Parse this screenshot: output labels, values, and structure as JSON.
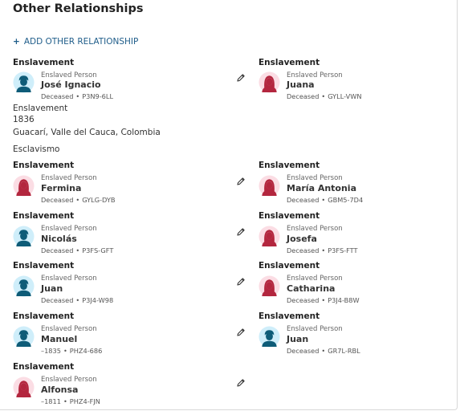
{
  "section": {
    "title": "Other Relationships",
    "add_label": "ADD OTHER RELATIONSHIP",
    "add_icon": "plus-icon"
  },
  "colors": {
    "link": "#1f5d8a",
    "male_bg": "#cfeefa",
    "male_fg": "#0e5c78",
    "female_bg": "#fbdde4",
    "female_fg": "#b3263e"
  },
  "relationships": [
    {
      "label": "Enslavement",
      "person1": {
        "gender": "male",
        "role": "Enslaved Person",
        "name": "José Ignacio",
        "status": "Deceased",
        "id": "P3N9-6LL"
      },
      "person2": {
        "gender": "female",
        "role": "Enslaved Person",
        "name": "Juana",
        "status": "Deceased",
        "id": "GYLL-VWN"
      },
      "details": [
        "Enslavement",
        "1836",
        "Guacarí, Valle del Cauca, Colombia",
        "Esclavismo"
      ]
    },
    {
      "label": "Enslavement",
      "person1": {
        "gender": "female",
        "role": "Enslaved Person",
        "name": "Fermina",
        "status": "Deceased",
        "id": "GYLG-DYB"
      },
      "person2": {
        "gender": "female",
        "role": "Enslaved Person",
        "name": "María Antonia",
        "status": "Deceased",
        "id": "GBM5-7D4"
      }
    },
    {
      "label": "Enslavement",
      "person1": {
        "gender": "male",
        "role": "Enslaved Person",
        "name": "Nicolás",
        "status": "Deceased",
        "id": "P3FS-GFT"
      },
      "person2": {
        "gender": "female",
        "role": "Enslaved Person",
        "name": "Josefa",
        "status": "Deceased",
        "id": "P3FS-FTT"
      }
    },
    {
      "label": "Enslavement",
      "person1": {
        "gender": "male",
        "role": "Enslaved Person",
        "name": "Juan",
        "status": "Deceased",
        "id": "P3J4-W98"
      },
      "person2": {
        "gender": "female",
        "role": "Enslaved Person",
        "name": "Catharina",
        "status": "Deceased",
        "id": "P3J4-B8W"
      }
    },
    {
      "label": "Enslavement",
      "person1": {
        "gender": "male",
        "role": "Enslaved Person",
        "name": "Manuel",
        "status": "–1835",
        "id": "PHZ4-686"
      },
      "person2": {
        "gender": "male",
        "role": "Enslaved Person",
        "name": "Juan",
        "status": "Deceased",
        "id": "GR7L-RBL"
      }
    },
    {
      "label": "Enslavement",
      "person1": {
        "gender": "female",
        "role": "Enslaved Person",
        "name": "Alfonsa",
        "status": "–1811",
        "id": "PHZ4-FJN"
      }
    }
  ]
}
